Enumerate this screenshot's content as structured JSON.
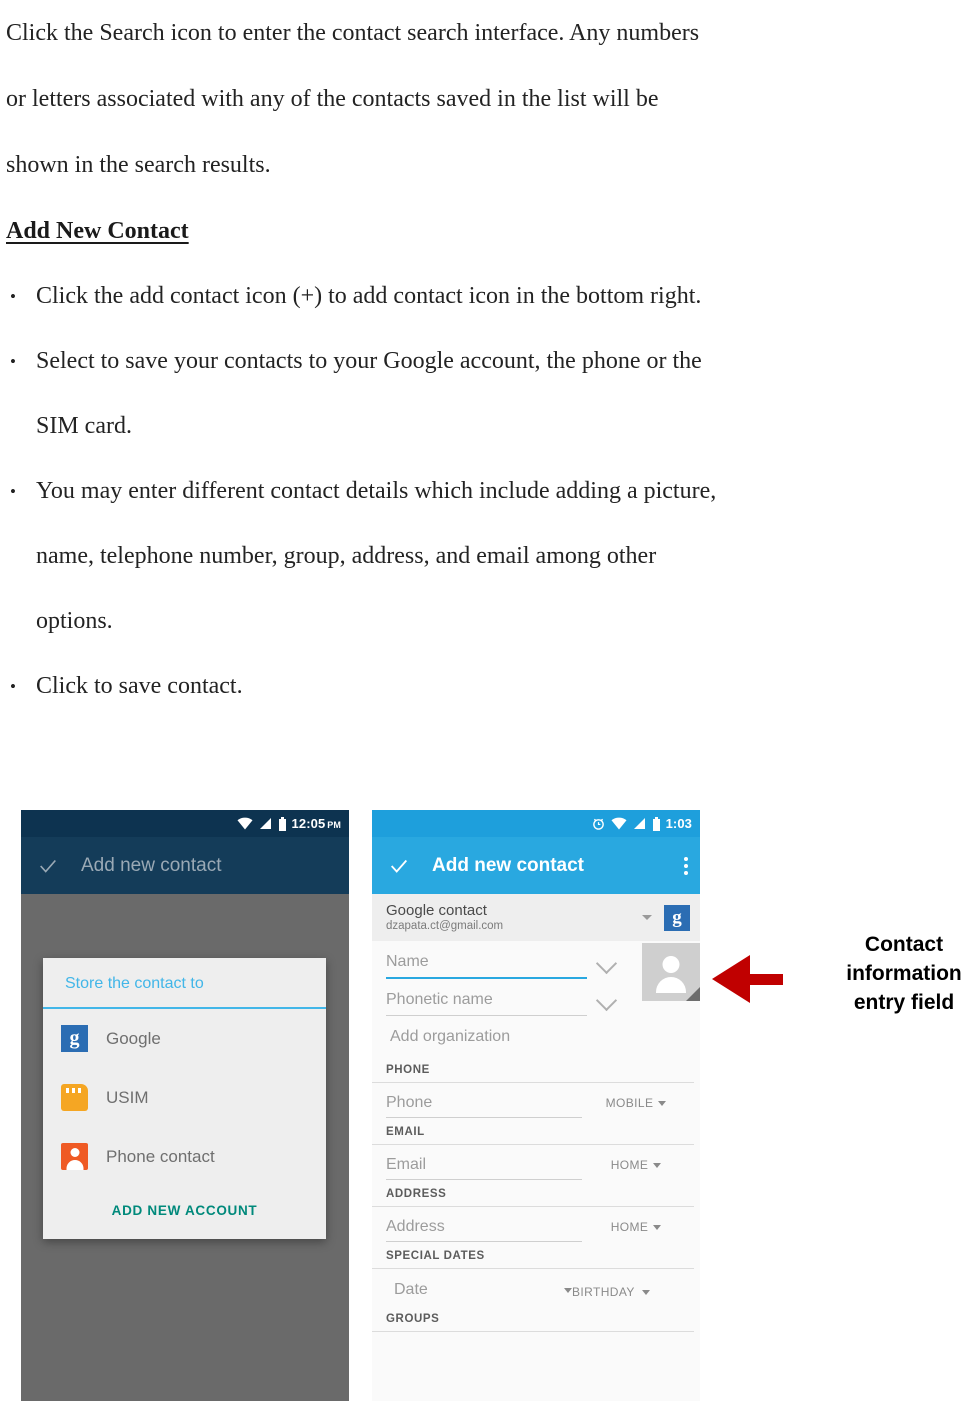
{
  "document": {
    "intro_paragraph": {
      "lines": [
        "Click the Search icon to enter the contact search interface. Any numbers",
        "or letters associated with any of the contacts saved in the list will be",
        "shown in the search results."
      ]
    },
    "heading": "Add New Contact",
    "bullets": [
      {
        "lines": [
          "Click the add contact icon (+) to add contact icon in the bottom right."
        ]
      },
      {
        "lines": [
          "Select to save your contacts to your Google account, the phone or the",
          "SIM card."
        ]
      },
      {
        "lines": [
          "You may enter different contact details which include adding a picture,",
          "name, telephone number, group, address, and email among other",
          "options."
        ]
      },
      {
        "lines": [
          "Click to save contact."
        ]
      }
    ]
  },
  "left_phone": {
    "status_bar": {
      "time": "12:05",
      "ampm": "PM",
      "icons": [
        "wifi-icon",
        "signal-icon",
        "battery-icon"
      ]
    },
    "app_bar": {
      "confirm_icon": "check-icon",
      "title": "Add new contact"
    },
    "dialog": {
      "title": "Store the contact to",
      "options": [
        {
          "icon": "google-icon",
          "label": "Google"
        },
        {
          "icon": "sim-card-icon",
          "label": "USIM"
        },
        {
          "icon": "person-icon",
          "label": "Phone contact"
        }
      ],
      "action": "ADD NEW ACCOUNT"
    }
  },
  "right_phone": {
    "status_bar": {
      "time": "1:03",
      "icons": [
        "alarm-icon",
        "wifi-icon",
        "signal-icon",
        "battery-icon"
      ]
    },
    "app_bar": {
      "confirm_icon": "check-icon",
      "title": "Add new contact",
      "overflow_icon": "kebab-menu-icon"
    },
    "account": {
      "name": "Google contact",
      "email": "dzapata.ct@gmail.com",
      "badge": "google-icon"
    },
    "fields": {
      "name_placeholder": "Name",
      "phonetic_name_placeholder": "Phonetic name",
      "add_organization": "Add organization"
    },
    "sections": [
      {
        "header": "PHONE",
        "field_placeholder": "Phone",
        "type_label": "MOBILE"
      },
      {
        "header": "EMAIL",
        "field_placeholder": "Email",
        "type_label": "HOME"
      },
      {
        "header": "ADDRESS",
        "field_placeholder": "Address",
        "type_label": "HOME"
      }
    ],
    "special_dates": {
      "header": "SPECIAL DATES",
      "field_placeholder": "Date",
      "type_label": "BIRTHDAY"
    },
    "groups": {
      "header": "GROUPS"
    }
  },
  "annotation": {
    "arrow_icon": "left-arrow-icon",
    "color": "#C00000",
    "lines": [
      "Contact",
      "information",
      "entry field"
    ]
  }
}
